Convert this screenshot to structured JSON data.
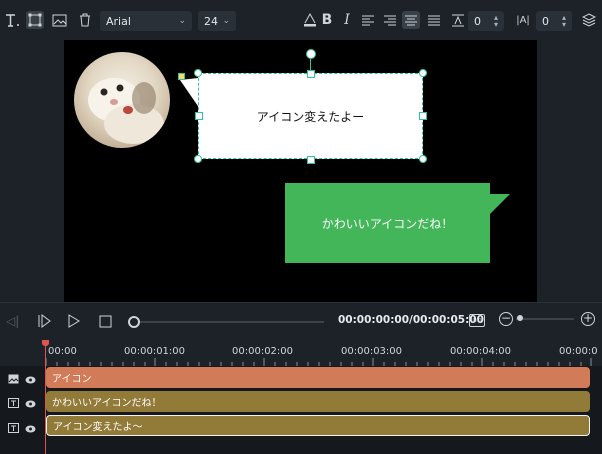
{
  "toolbar": {
    "font_family": "Arial",
    "font_size": "24",
    "line_spacing": "0",
    "char_spacing": "0",
    "icons": [
      "text-tool-icon",
      "transform-icon",
      "image-icon",
      "trash-icon",
      "bold-icon",
      "italic-icon",
      "align-left-icon",
      "align-right-icon",
      "align-center-icon",
      "justify-icon",
      "line-spacing-icon",
      "char-spacing-icon",
      "layers-icon"
    ]
  },
  "canvas": {
    "bubble_selected_text": "アイコン変えたよー",
    "bubble_green_text": "かわいいアイコンだね！",
    "green_color": "#43b65a"
  },
  "playback": {
    "timecode": "00:00:00:00/00:00:05:00"
  },
  "timeline": {
    "ruler": [
      "00:00",
      "00:00:01:00",
      "00:00:02:00",
      "00:00:03:00",
      "00:00:04:00",
      "00:00:0"
    ],
    "tracks": [
      {
        "label": "アイコン",
        "color": "#d27b58"
      },
      {
        "label": "かわいいアイコンだね！",
        "color": "#927a39"
      },
      {
        "label": "アイコン変えたよ〜",
        "color": "#927a39"
      }
    ]
  }
}
